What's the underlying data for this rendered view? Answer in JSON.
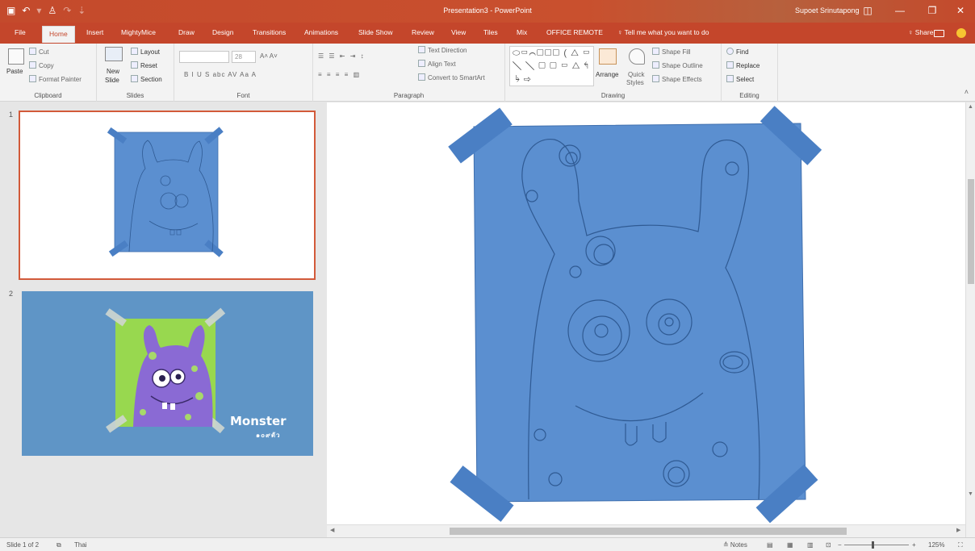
{
  "app": {
    "window_title": "Presentation3 - PowerPoint",
    "user": "Supoet Srinutapong"
  },
  "quick_access": {
    "save_icon": "save-icon",
    "undo_icon": "undo-icon",
    "redo_icon": "redo-icon",
    "customize_icon": "customize-qat-icon"
  },
  "window_buttons": {
    "ribbon_options": "◫",
    "minimize": "—",
    "restore": "❐",
    "close": "✕"
  },
  "tabs": [
    {
      "label": "File"
    },
    {
      "label": "Home"
    },
    {
      "label": "Insert"
    },
    {
      "label": "MightyMice"
    },
    {
      "label": "Draw"
    },
    {
      "label": "Design"
    },
    {
      "label": "Transitions"
    },
    {
      "label": "Animations"
    },
    {
      "label": "Slide Show"
    },
    {
      "label": "Review"
    },
    {
      "label": "View"
    },
    {
      "label": "Tiles"
    },
    {
      "label": "Mix"
    },
    {
      "label": "OFFICE REMOTE"
    }
  ],
  "tell_me": "♀ Tell me what you want to do",
  "share": "♀ Share",
  "ribbon": {
    "clipboard": {
      "label": "Clipboard",
      "paste": "Paste",
      "cut": "Cut",
      "copy": "Copy",
      "format_painter": "Format Painter"
    },
    "slides": {
      "label": "Slides",
      "new_slide": "New",
      "new_slide_2": "Slide",
      "layout": "Layout",
      "reset": "Reset",
      "section": "Section"
    },
    "font": {
      "label": "Font",
      "size": "28",
      "controls": "B  I  U  S  abc  AV  Aa  A",
      "grow": "A˄  A˅"
    },
    "paragraph": {
      "label": "Paragraph",
      "text_direction": "Text Direction",
      "align_text": "Align Text",
      "convert_smartart": "Convert to SmartArt"
    },
    "drawing": {
      "label": "Drawing",
      "arrange": "Arrange",
      "quick_styles": "Quick",
      "quick_styles_2": "Styles",
      "shape_fill": "Shape Fill",
      "shape_outline": "Shape Outline",
      "shape_effects": "Shape Effects",
      "shapes_preview": "⬭▭⌒▢▢▢ ( △ ▭ ╲ ╲ ▢ ▢ ▭ △ ↰ ↳ ⇨"
    },
    "editing": {
      "label": "Editing",
      "find": "Find",
      "replace": "Replace",
      "select": "Select"
    }
  },
  "slides": [
    {
      "number": "1"
    },
    {
      "number": "2",
      "title": "Monster",
      "subtitle": "๑๐๙ตัว"
    }
  ],
  "statusbar": {
    "slide_info": "Slide 1 of 2",
    "language": "Thai",
    "notes": "≙ Notes",
    "zoom": "125%"
  },
  "colors": {
    "accent": "#c4462b",
    "monster_blue": "#5b8fd0",
    "tape_blue": "#4a7fc4",
    "slide2_bg": "#5f95c6",
    "monster_purple": "#8a6ad4",
    "monster_green": "#98d84f"
  }
}
